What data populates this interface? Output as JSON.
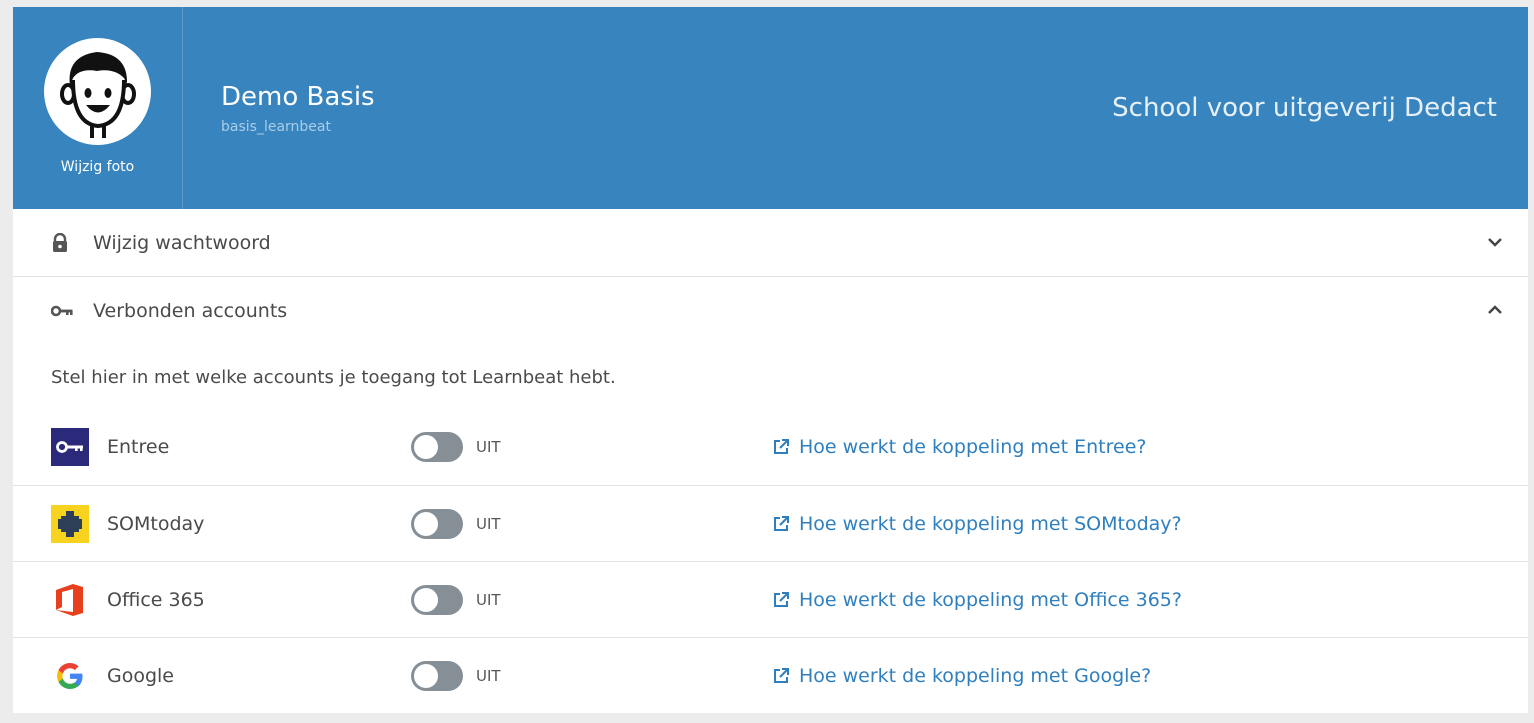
{
  "profile": {
    "change_photo_label": "Wijzig foto",
    "name": "Demo Basis",
    "username": "basis_learnbeat",
    "school": "School voor uitgeverij Dedact"
  },
  "sections": {
    "password": {
      "label": "Wijzig wachtwoord",
      "icon": "lock-icon",
      "expanded": false
    },
    "accounts": {
      "label": "Verbonden accounts",
      "icon": "key-icon",
      "expanded": true
    }
  },
  "accounts_intro": "Stel hier in met welke accounts je toegang tot Learnbeat hebt.",
  "accounts": [
    {
      "name": "Entree",
      "state": "UIT",
      "link": "Hoe werkt de koppeling met Entree?",
      "icon": "entree-logo"
    },
    {
      "name": "SOMtoday",
      "state": "UIT",
      "link": "Hoe werkt de koppeling met SOMtoday?",
      "icon": "somtoday-logo"
    },
    {
      "name": "Office 365",
      "state": "UIT",
      "link": "Hoe werkt de koppeling met Office 365?",
      "icon": "office365-logo"
    },
    {
      "name": "Google",
      "state": "UIT",
      "link": "Hoe werkt de koppeling met Google?",
      "icon": "google-logo"
    }
  ],
  "colors": {
    "header_bg": "#3884be",
    "link": "#2f7fbf",
    "toggle_off": "#868e96",
    "page_bg": "#ececec"
  }
}
